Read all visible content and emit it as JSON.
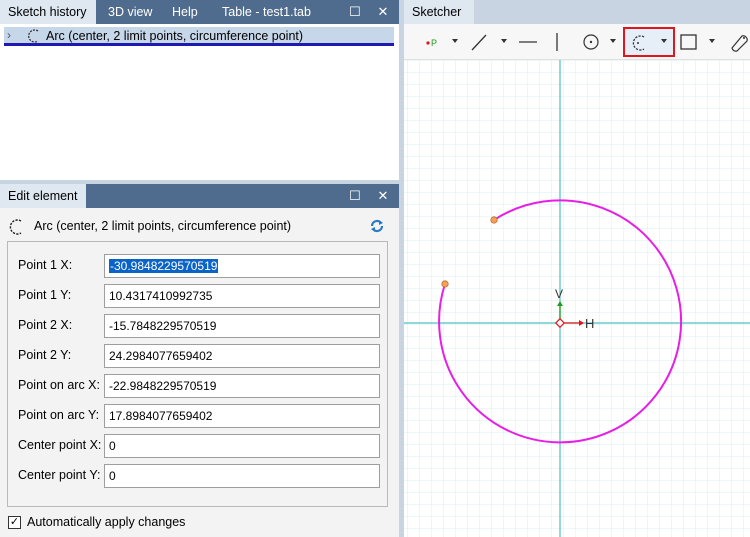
{
  "left_top": {
    "tabs": [
      "Sketch history",
      "3D view",
      "Help",
      "Table - test1.tab"
    ],
    "history_item": "Arc (center, 2 limit points, circumference point)"
  },
  "left_bottom": {
    "tab": "Edit element",
    "element_title": "Arc (center, 2 limit points, circumference point)",
    "fields": [
      {
        "label": "Point 1 X:",
        "value": "-30.9848229570519"
      },
      {
        "label": "Point 1 Y:",
        "value": "10.4317410992735"
      },
      {
        "label": "Point 2 X:",
        "value": "-15.7848229570519"
      },
      {
        "label": "Point 2 Y:",
        "value": "24.2984077659402"
      },
      {
        "label": "Point on arc X:",
        "value": "-22.9848229570519"
      },
      {
        "label": "Point on arc Y:",
        "value": "17.8984077659402"
      },
      {
        "label": "Center point X:",
        "value": "0"
      },
      {
        "label": "Center point Y:",
        "value": "0"
      }
    ],
    "auto_apply_label": "Automatically apply changes",
    "auto_apply_checked": "✓"
  },
  "right": {
    "tab": "Sketcher",
    "axis_h_label": "H",
    "axis_v_label": "V",
    "colors": {
      "arc": "#e61ee6",
      "axis": "#4fc1c0",
      "grid": "#d6f0f2",
      "endpoint": "#f5a05a",
      "highlight": "#e0161d"
    }
  }
}
